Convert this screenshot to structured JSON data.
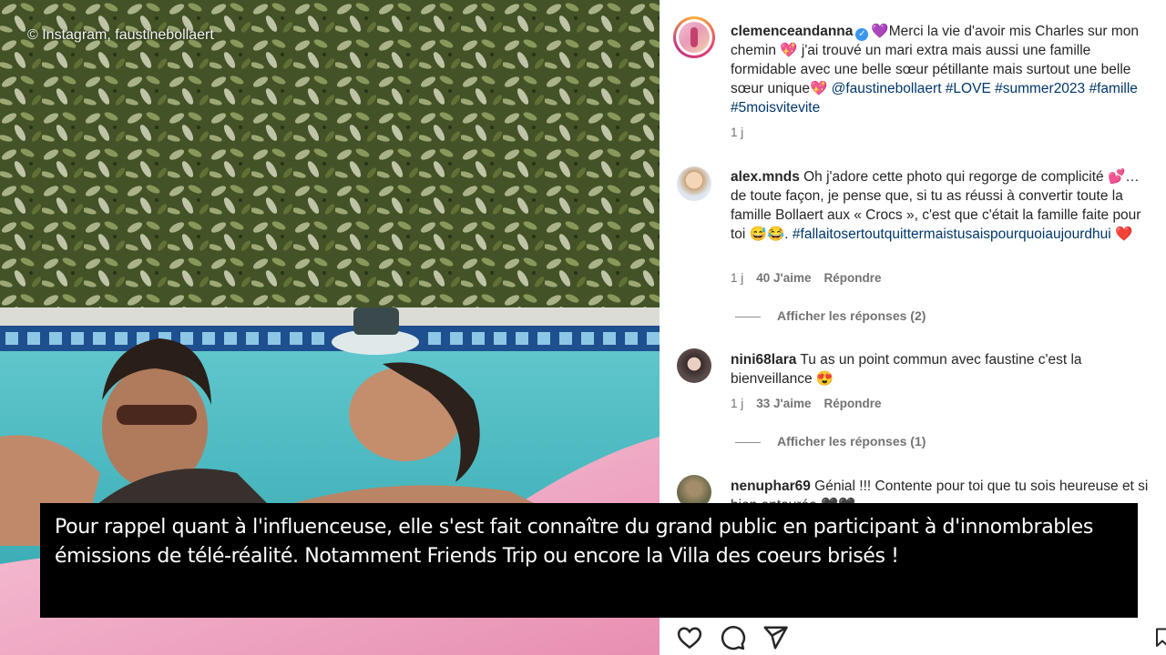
{
  "photo": {
    "watermark": "© Instagram, faustinebollaert"
  },
  "post": {
    "username": "clemenceandanna",
    "verified": true,
    "caption_emoji_start": "💜",
    "caption_part1": "Merci la vie d'avoir mis Charles sur mon chemin",
    "caption_emoji_mid": "💖",
    "caption_part2": " j'ai trouvé un mari extra mais aussi une famille formidable avec une belle sœur pétillante mais surtout une belle sœur unique",
    "caption_emoji_end": "💖",
    "mention": "@faustinebollaert",
    "hashtags": "#LOVE #summer2023",
    "hashtags2": "#famille #5moisvitevite",
    "time": "1 j"
  },
  "comments": [
    {
      "username": "alex.mnds",
      "text1": "Oh j'adore cette photo qui regorge de complicité",
      "text2": "💕… de toute façon, je pense que, si tu as réussi à convertir toute la famille Bollaert aux « Crocs », c'est que c'était la famille faite pour toi 😅😂.",
      "hashtag": "#fallaitosertoutquittermaistusaispourquoiaujourdhui",
      "emoji_end": "❤️",
      "time": "1 j",
      "likes": "40 J'aime",
      "reply": "Répondre",
      "show_replies": "Afficher les réponses (2)"
    },
    {
      "username": "nini68lara",
      "text1": "Tu as un point commun avec faustine c'est la bienveillance 😍",
      "time": "1 j",
      "likes": "33 J'aime",
      "reply": "Répondre",
      "show_replies": "Afficher les réponses (1)"
    },
    {
      "username": "nenuphar69",
      "text1": "Génial !!! Contente pour toi que tu sois heureuse et si bien entourée 🖤🖤"
    }
  ],
  "subtitle": "Pour rappel quant à l'influenceuse, elle s'est fait connaître du grand public en participant à d'innombrables émissions de télé-réalité. Notamment Friends Trip ou encore la Villa des coeurs brisés !",
  "colors": {
    "hashtag": "#00376b",
    "verified": "#3897f0",
    "meta_gray": "#737373"
  },
  "icons": [
    "heart-icon",
    "comment-icon",
    "share-icon",
    "bookmark-icon"
  ]
}
